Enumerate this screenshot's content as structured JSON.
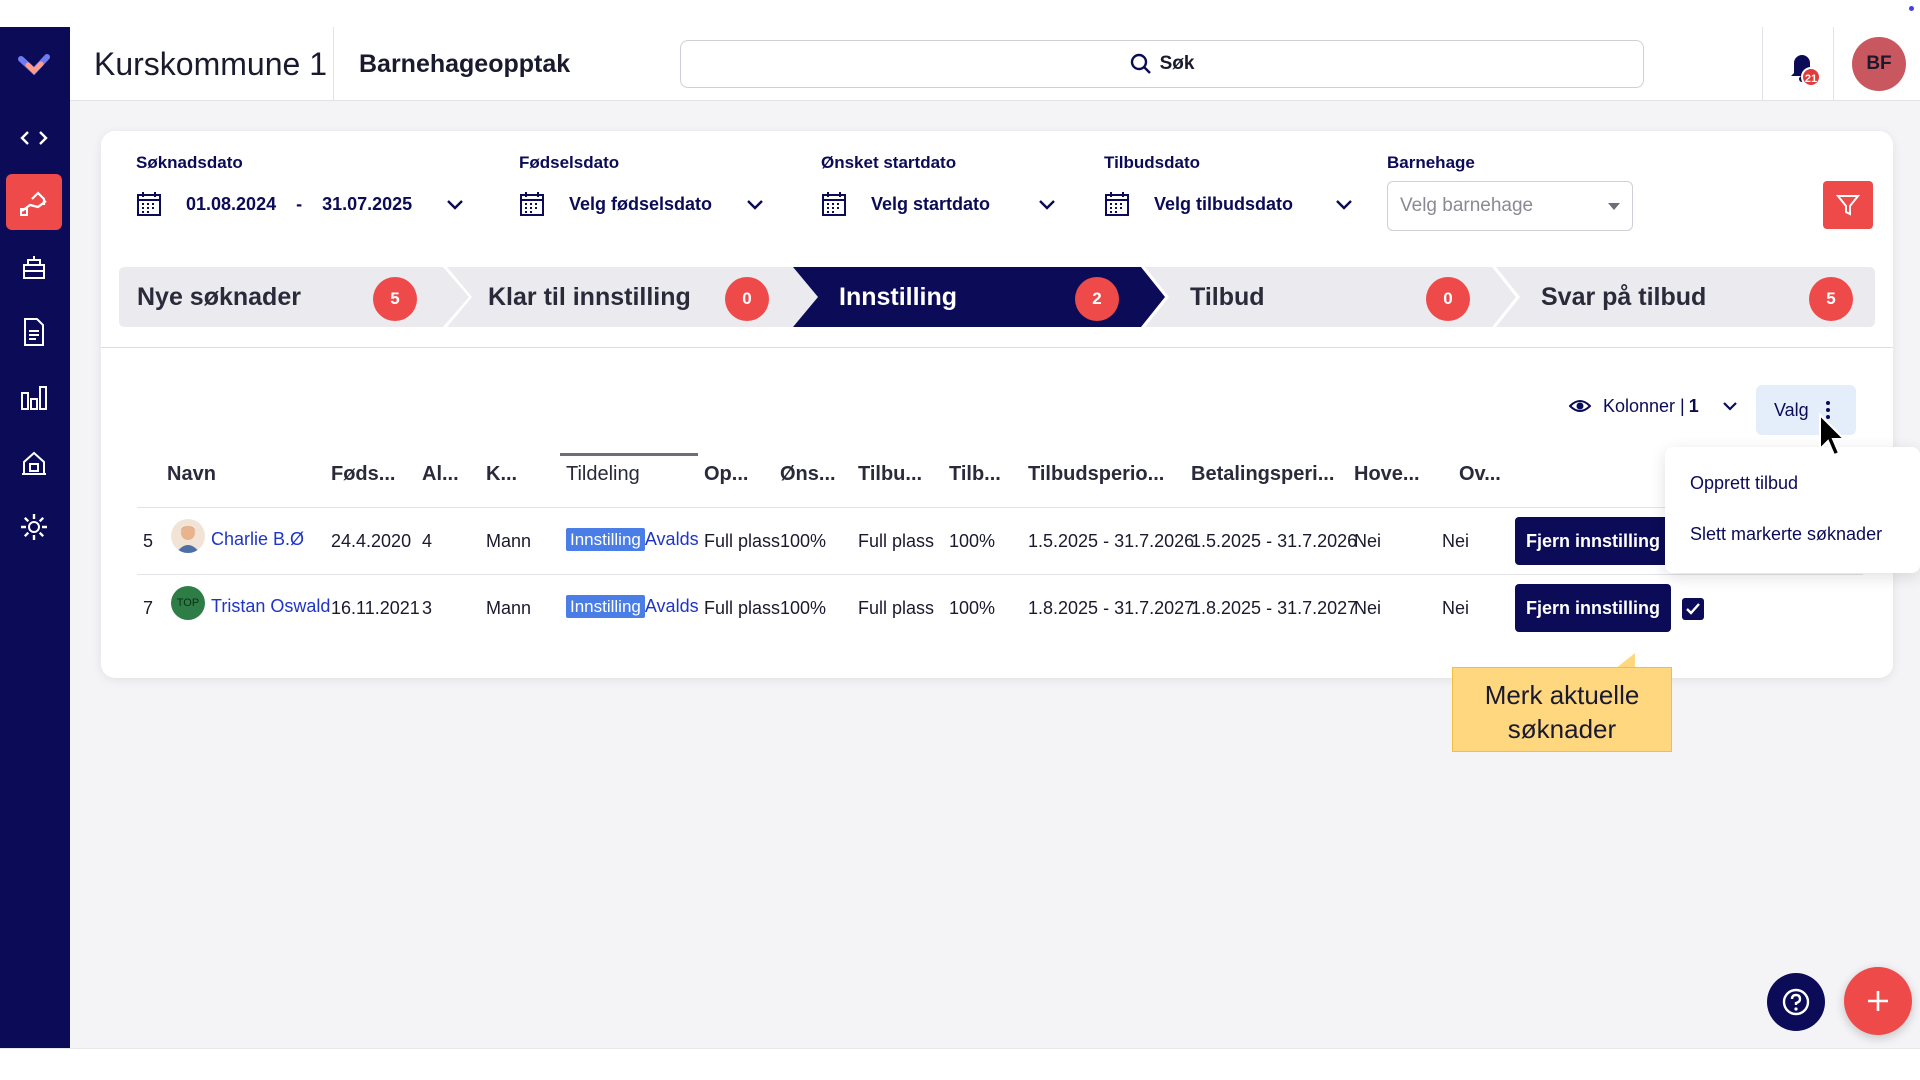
{
  "header": {
    "title": "Kurskommune 1",
    "module": "Barnehageopptak",
    "search_label": "Søk",
    "notification_count": "21",
    "user_initials": "BF"
  },
  "filters": {
    "soknadsdato": {
      "label": "Søknadsdato",
      "from": "01.08.2024",
      "separator": "-",
      "to": "31.07.2025"
    },
    "fodselsdato": {
      "label": "Fødselsdato",
      "value": "Velg fødselsdato"
    },
    "startdato": {
      "label": "Ønsket startdato",
      "value": "Velg startdato"
    },
    "tilbudsdato": {
      "label": "Tilbudsdato",
      "value": "Velg tilbudsdato"
    },
    "barnehage": {
      "label": "Barnehage",
      "placeholder": "Velg barnehage"
    }
  },
  "steps": [
    {
      "label": "Nye søknader",
      "count": "5"
    },
    {
      "label": "Klar til innstilling",
      "count": "0"
    },
    {
      "label": "Innstilling",
      "count": "2"
    },
    {
      "label": "Tilbud",
      "count": "0"
    },
    {
      "label": "Svar på tilbud",
      "count": "5"
    }
  ],
  "toolbar": {
    "kolonner_label": "Kolonner |",
    "kolonner_count": "1",
    "valg_label": "Valg"
  },
  "columns": [
    "Navn",
    "Føds...",
    "Al...",
    "K...",
    "Tildeling",
    "Op...",
    "Øns...",
    "Tilbu...",
    "Tilb...",
    "Tilbudsperio...",
    "Betalingsperi...",
    "Hove...",
    "Ov..."
  ],
  "rows": [
    {
      "num": "5",
      "name": "Charlie B.Ø",
      "birth": "24.4.2020",
      "age": "4",
      "gender": "Mann",
      "tag": "Innstilling",
      "tag_link": "Avalds",
      "op": "Full plass",
      "onsket": "100%",
      "tilbud_type": "Full plass",
      "tilbud_pct": "100%",
      "tilbudsperiode": "1.5.2025 - 31.7.2026",
      "betalingsperiode": "1.5.2025 - 31.7.2026",
      "hoved": "Nei",
      "ov": "Nei",
      "action": "Fjern innstilling"
    },
    {
      "num": "7",
      "name": "Tristan Oswald",
      "avatar_text": "TOP",
      "birth": "16.11.2021",
      "age": "3",
      "gender": "Mann",
      "tag": "Innstilling",
      "tag_link": "Avalds",
      "op": "Full plass",
      "onsket": "100%",
      "tilbud_type": "Full plass",
      "tilbud_pct": "100%",
      "tilbudsperiode": "1.8.2025 - 31.7.2027",
      "betalingsperiode": "1.8.2025 - 31.7.2027",
      "hoved": "Nei",
      "ov": "Nei",
      "action": "Fjern innstilling"
    }
  ],
  "menu": {
    "items": [
      "Opprett tilbud",
      "Slett markerte søknader"
    ]
  },
  "tooltip": {
    "line1": "Merk aktuelle",
    "line2": "søknader"
  },
  "colors": {
    "navy": "#0b0b57",
    "accent": "#ef4a4a",
    "link": "#1f34c8",
    "tag": "#4a7ee6",
    "tooltip": "#ffd77e"
  }
}
